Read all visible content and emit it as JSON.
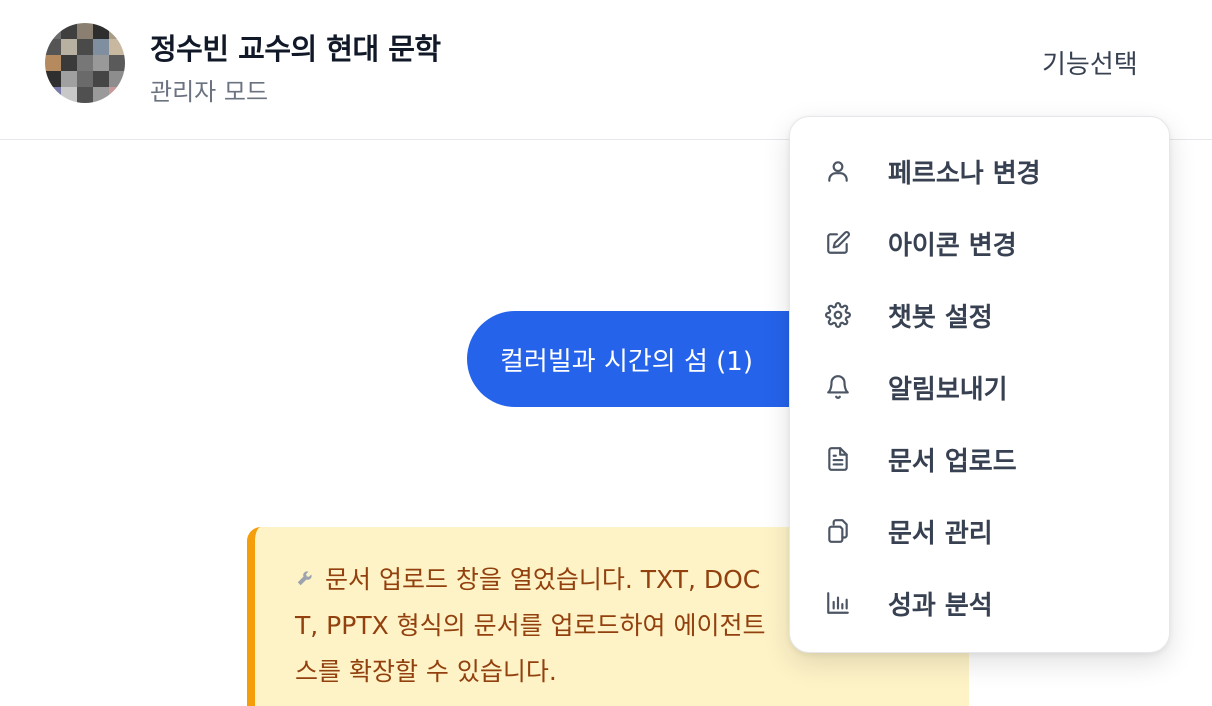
{
  "header": {
    "title": "정수빈 교수의 현대 문학",
    "subtitle": "관리자 모드",
    "feature_select_label": "기능선택"
  },
  "chat": {
    "user_message": "컬러빌과 시간의 섬 (1)",
    "system_notice": {
      "icon": "wrench-icon",
      "lines": [
        "문서 업로드 창을 열었습니다. TXT, DOC",
        "T, PPTX 형식의 문서를 업로드하여 에이전트",
        "스를 확장할 수 있습니다."
      ]
    }
  },
  "menu": {
    "items": [
      {
        "label": "페르소나 변경",
        "icon": "user-icon"
      },
      {
        "label": "아이콘 변경",
        "icon": "edit-icon"
      },
      {
        "label": "챗봇 설정",
        "icon": "gear-icon"
      },
      {
        "label": "알림보내기",
        "icon": "bell-icon"
      },
      {
        "label": "문서 업로드",
        "icon": "document-icon"
      },
      {
        "label": "문서 관리",
        "icon": "files-icon"
      },
      {
        "label": "성과 분석",
        "icon": "bar-chart-icon"
      }
    ]
  },
  "colors": {
    "accent": "#2563eb",
    "notice_bg": "#fef3c7",
    "notice_border": "#f59e0b",
    "notice_text": "#92400e"
  }
}
